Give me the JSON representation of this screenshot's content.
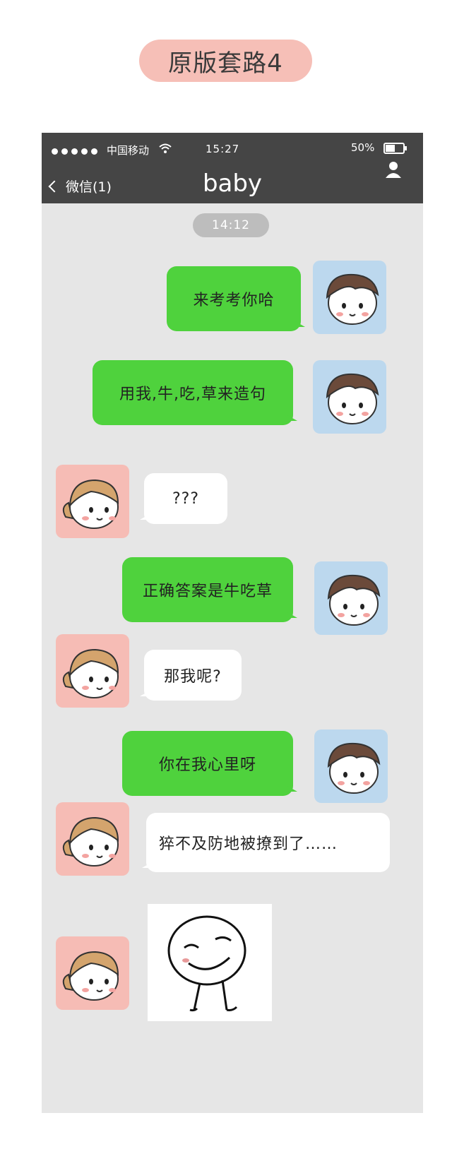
{
  "header_title": "原版套路4",
  "status_bar": {
    "carrier": "中国移动",
    "time": "15:27",
    "battery": "50%",
    "wifi_icon": "wifi-icon",
    "battery_icon": "battery-icon"
  },
  "nav": {
    "back_label": "微信(1)",
    "chat_title": "baby",
    "profile_icon": "person-icon"
  },
  "timestamp": "14:12",
  "messages": [
    {
      "sender": "me",
      "text": "来考考你哈"
    },
    {
      "sender": "me",
      "text": "用我,牛,吃,草来造句"
    },
    {
      "sender": "her",
      "text": "???"
    },
    {
      "sender": "me",
      "text": "正确答案是牛吃草"
    },
    {
      "sender": "her",
      "text": "那我呢?"
    },
    {
      "sender": "me",
      "text": "你在我心里呀"
    },
    {
      "sender": "her",
      "text": "猝不及防地被撩到了……"
    },
    {
      "sender": "her",
      "sticker": "smug-face-sticker"
    }
  ],
  "colors": {
    "status_bar": "#454545",
    "chat_bg": "#e6e6e6",
    "my_bubble": "#4fd23d",
    "her_bubble": "#ffffff",
    "boy_avatar_bg": "#bcd8ee",
    "girl_avatar_bg": "#f6bcb5",
    "title_pill": "#f6bfb7"
  }
}
